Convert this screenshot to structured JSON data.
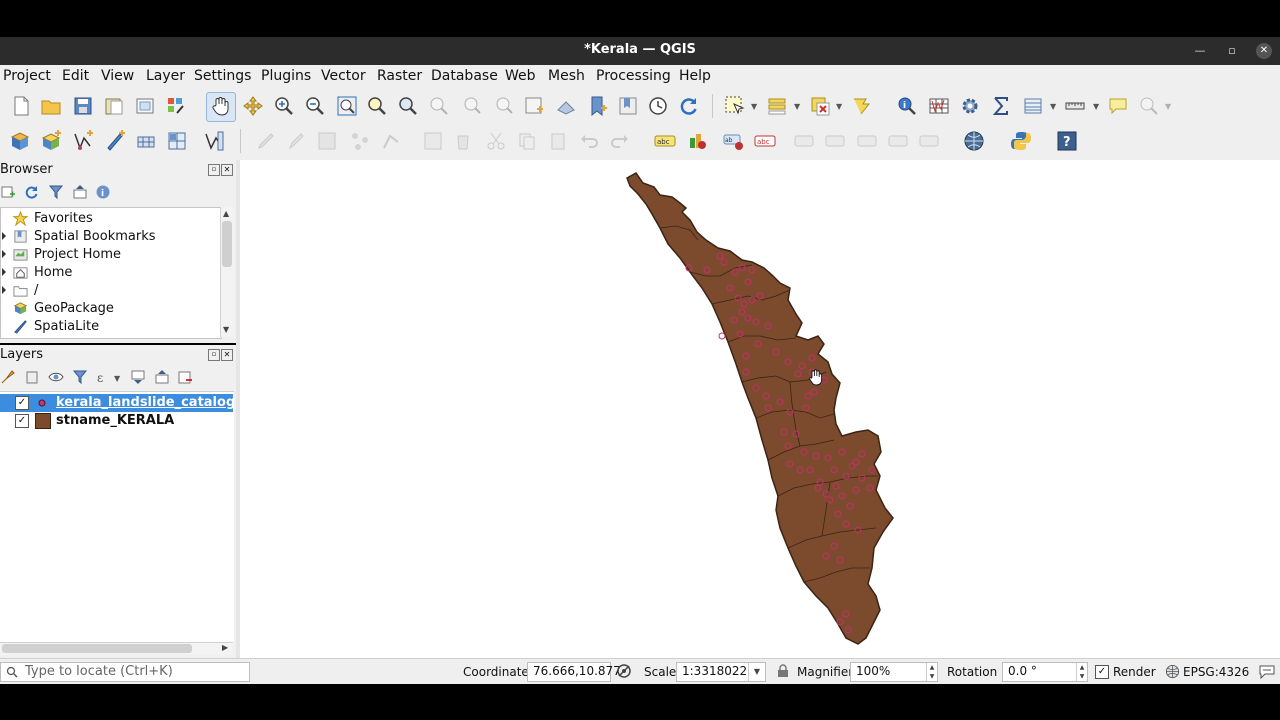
{
  "window": {
    "title": "*Kerala — QGIS"
  },
  "menu": [
    "Project",
    "Edit",
    "View",
    "Layer",
    "Settings",
    "Plugins",
    "Vector",
    "Raster",
    "Database",
    "Web",
    "Mesh",
    "Processing",
    "Help"
  ],
  "browser": {
    "title": "Browser",
    "items": [
      {
        "label": "Favorites",
        "icon": "star-icon"
      },
      {
        "label": "Spatial Bookmarks",
        "icon": "bookmark-icon"
      },
      {
        "label": "Project Home",
        "icon": "project-home-icon"
      },
      {
        "label": "Home",
        "icon": "home-folder-icon"
      },
      {
        "label": "/",
        "icon": "folder-icon"
      },
      {
        "label": "GeoPackage",
        "icon": "geopackage-icon"
      },
      {
        "label": "SpatiaLite",
        "icon": "spatialite-icon"
      }
    ]
  },
  "layers": {
    "title": "Layers",
    "items": [
      {
        "label": "kerala_landslide_catalog_",
        "checked": true,
        "selected": true,
        "symbol": "point",
        "color": "#c03a6a"
      },
      {
        "label": "stname_KERALA",
        "checked": true,
        "selected": false,
        "symbol": "fill",
        "color": "#7c4a2d"
      }
    ]
  },
  "status": {
    "locate_placeholder": "Type to locate (Ctrl+K)",
    "coordinate_label": "Coordinate",
    "coordinate_value": "76.666,10.877",
    "scale_label": "Scale",
    "scale_value": "1:3318022",
    "magnifier_label": "Magnifier",
    "magnifier_value": "100%",
    "rotation_label": "Rotation",
    "rotation_value": "0.0 °",
    "render_label": "Render",
    "crs": "EPSG:4326"
  },
  "colors": {
    "state_fill": "#7c4a2d",
    "state_border": "#3a2414",
    "point_stroke": "#c4306a",
    "selection": "#3c8de0"
  }
}
